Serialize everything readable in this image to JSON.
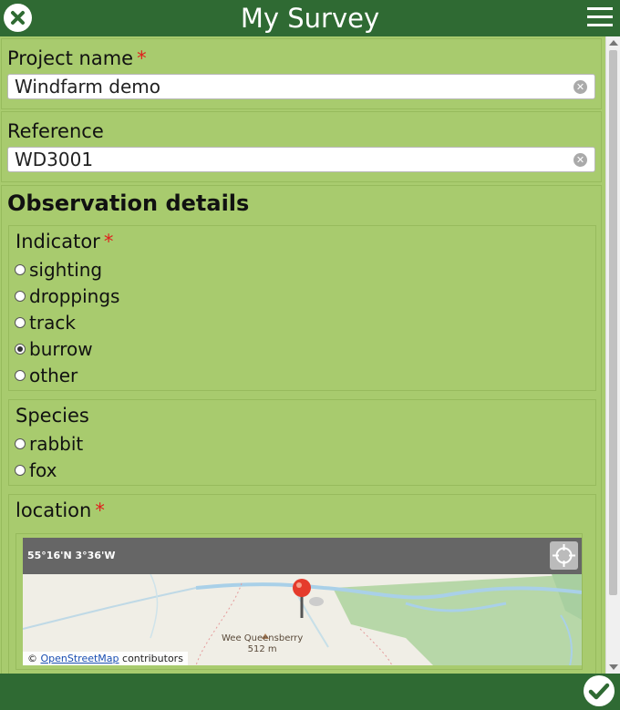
{
  "app": {
    "title": "My Survey"
  },
  "fields": {
    "project_name": {
      "label": "Project name",
      "required_mark": "*",
      "value": "Windfarm demo"
    },
    "reference": {
      "label": "Reference",
      "value": "WD3001"
    }
  },
  "observation": {
    "title": "Observation details",
    "indicator": {
      "label": "Indicator",
      "required_mark": "*",
      "options": [
        "sighting",
        "droppings",
        "track",
        "burrow",
        "other"
      ],
      "selected": "burrow"
    },
    "species": {
      "label": "Species",
      "options": [
        "rabbit",
        "fox"
      ],
      "selected": ""
    },
    "location": {
      "label": "location",
      "required_mark": "*",
      "coords": "55°16'N 3°36'W",
      "peak_name": "Wee Queensberry",
      "peak_height": "512 m",
      "attribution_symbol": "©",
      "attribution_link": "OpenStreetMap",
      "attribution_suffix": "contributors"
    }
  },
  "icons": {
    "close": "close-icon",
    "menu": "menu-icon",
    "confirm": "checkmark-icon",
    "locate": "crosshair-icon",
    "pin": "map-pin-icon",
    "clear": "clear-field-icon"
  },
  "colors": {
    "header": "#2f6a33",
    "form_background": "#a8cb6e",
    "required": "#e0201e",
    "map_bar": "#666666",
    "pin": "#e53b2c"
  }
}
